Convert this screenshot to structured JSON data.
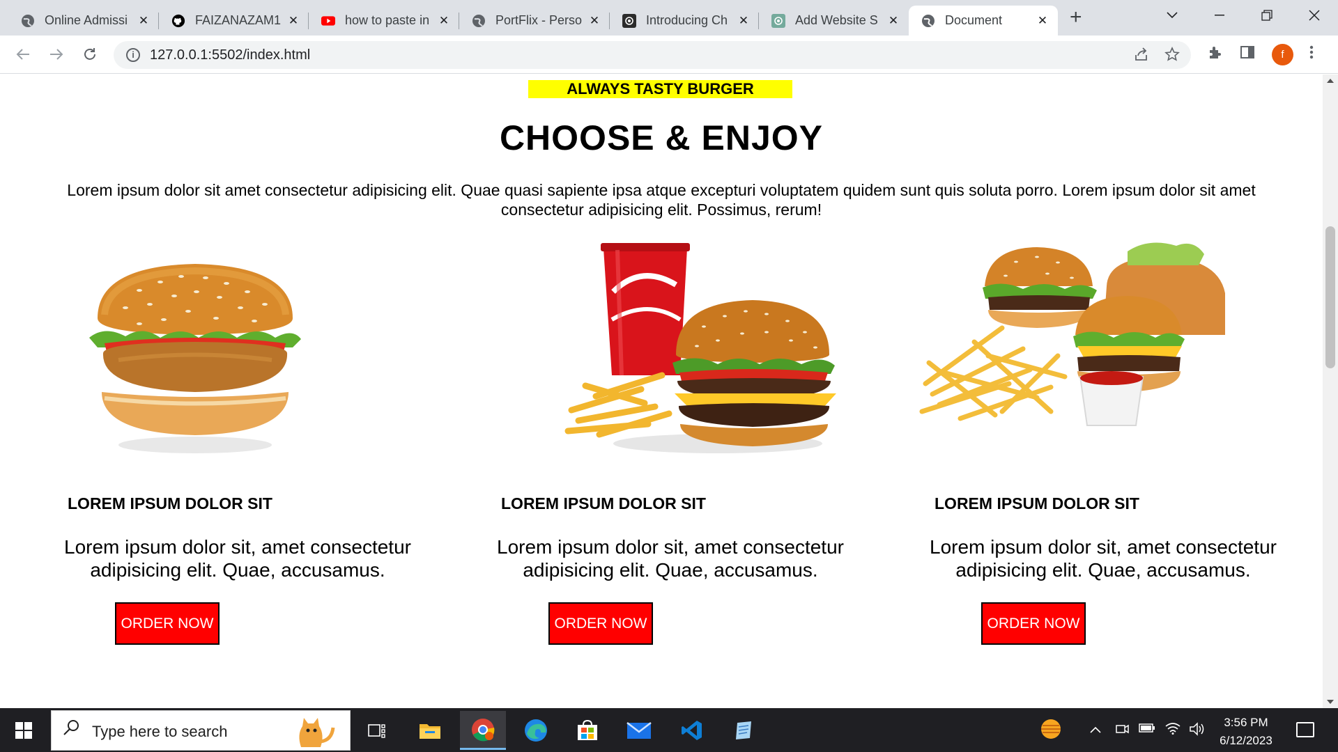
{
  "browser": {
    "tabs": [
      {
        "title": "Online Admissi",
        "favicon": "globe-icon"
      },
      {
        "title": "FAIZANAZAM1",
        "favicon": "github-icon"
      },
      {
        "title": "how to paste in",
        "favicon": "youtube-icon"
      },
      {
        "title": "PortFlix - Perso",
        "favicon": "globe-icon"
      },
      {
        "title": "Introducing Ch",
        "favicon": "openai-icon"
      },
      {
        "title": "Add Website S",
        "favicon": "openai-icon"
      },
      {
        "title": "Document",
        "favicon": "globe-icon",
        "active": true
      }
    ],
    "url": "127.0.0.1:5502/index.html",
    "profile_initial": "f"
  },
  "page": {
    "tagline": "ALWAYS TASTY BURGER",
    "heading": "CHOOSE & ENJOY",
    "intro": "Lorem ipsum dolor sit amet consectetur adipisicing elit. Quae quasi sapiente ipsa atque excepturi voluptatem quidem sunt quis soluta porro. Lorem ipsum dolor sit amet consectetur adipisicing elit. Possimus, rerum!",
    "cards": [
      {
        "image": "burger-image",
        "title": "LOREM IPSUM DOLOR SIT",
        "text": "Lorem ipsum dolor sit, amet consectetur adipisicing elit. Quae, accusamus.",
        "button": "ORDER NOW"
      },
      {
        "image": "cola-burger-fries-image",
        "title": "LOREM IPSUM DOLOR SIT",
        "text": "Lorem ipsum dolor sit, amet consectetur adipisicing elit. Quae, accusamus.",
        "button": "ORDER NOW"
      },
      {
        "image": "burgers-fries-ketchup-image",
        "title": "LOREM IPSUM DOLOR SIT",
        "text": "Lorem ipsum dolor sit, amet consectetur adipisicing elit. Quae, accusamus.",
        "button": "ORDER NOW"
      }
    ],
    "colors": {
      "tagline_bg": "#ffff00",
      "button_bg": "#ff0000",
      "button_text": "#ffffff"
    }
  },
  "taskbar": {
    "search_placeholder": "Type here to search",
    "time": "3:56 PM",
    "date": "6/12/2023",
    "apps": [
      "task-view-icon",
      "file-explorer-icon",
      "chrome-icon",
      "edge-icon",
      "store-icon",
      "mail-icon",
      "vscode-icon",
      "notepad-icon"
    ]
  }
}
